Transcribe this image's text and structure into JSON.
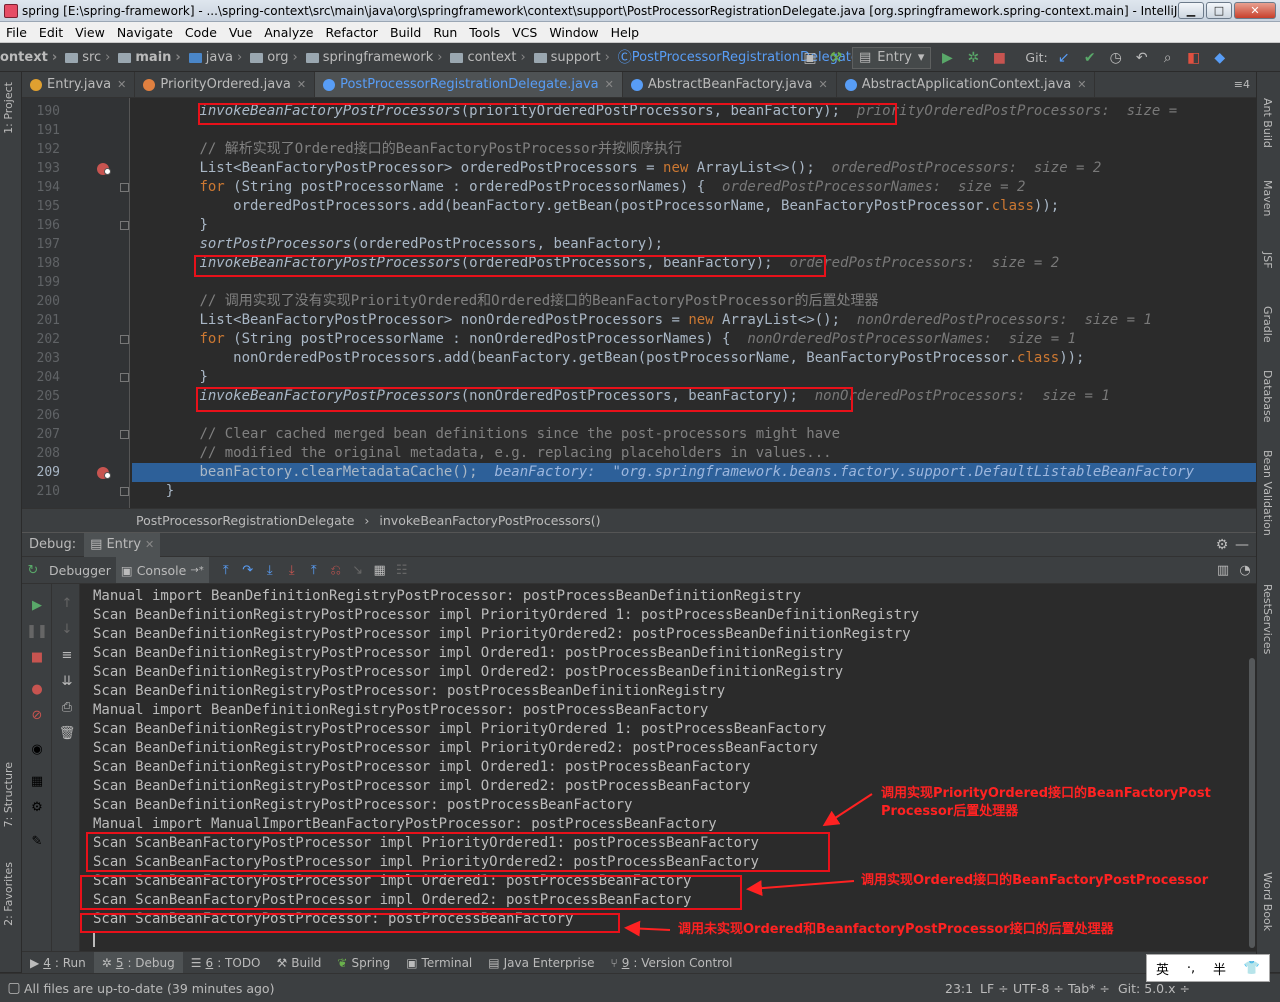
{
  "window": {
    "title": "spring [E:\\spring-framework] - ...\\spring-context\\src\\main\\java\\org\\springframework\\context\\support\\PostProcessorRegistrationDelegate.java [org.springframework.spring-context.main] - IntelliJ IDE...",
    "minimize": "▁",
    "maximize": "□",
    "close": "✕"
  },
  "menu": [
    "File",
    "Edit",
    "View",
    "Navigate",
    "Code",
    "Vue",
    "Analyze",
    "Refactor",
    "Build",
    "Run",
    "Tools",
    "VCS",
    "Window",
    "Help"
  ],
  "breadcrumbs": [
    "ontext",
    "src",
    "main",
    "java",
    "org",
    "springframework",
    "context",
    "support",
    "PostProcessorRegistrationDelegate"
  ],
  "run_config": "Entry",
  "git_label": "Git:",
  "tabs": [
    {
      "label": "Entry.java",
      "color": "#e0a030"
    },
    {
      "label": "PriorityOrdered.java",
      "color": "#e08040"
    },
    {
      "label": "PostProcessorRegistrationDelegate.java",
      "color": "#589df6"
    },
    {
      "label": "AbstractBeanFactory.java",
      "color": "#589df6"
    },
    {
      "label": "AbstractApplicationContext.java",
      "color": "#589df6"
    }
  ],
  "tab_overflow": "≡4",
  "left_tools": [
    "1: Project",
    "7: Structure",
    "2: Favorites"
  ],
  "right_tools": [
    "Ant Build",
    "Maven",
    "JSF",
    "Gradle",
    "Database",
    "Bean Validation",
    "RestServices",
    "Word Book"
  ],
  "line_numbers": [
    "190",
    "191",
    "192",
    "193",
    "194",
    "195",
    "196",
    "197",
    "198",
    "199",
    "200",
    "201",
    "202",
    "203",
    "204",
    "205",
    "206",
    "207",
    "208",
    "209",
    "210"
  ],
  "code": {
    "l190": [
      "invokeBeanFactoryPostProcessors",
      "(priorityOrderedPostProcessors, beanFactory);",
      "priorityOrderedPostProcessors:  size ="
    ],
    "l192": "// 解析实现了Ordered接口的BeanFactoryPostProcessor并按顺序执行",
    "l193": [
      "List<BeanFactoryPostProcessor> orderedPostProcessors = ",
      "new",
      " ArrayList<>();",
      "orderedPostProcessors:  size = 2"
    ],
    "l194": [
      "for",
      " (String postProcessorName : orderedPostProcessorNames) {",
      "orderedPostProcessorNames:  size = 2"
    ],
    "l195": [
      "orderedPostProcessors.add(beanFactory.getBean(postProcessorName, BeanFactoryPostProcessor.",
      "class",
      "));"
    ],
    "l196": "}",
    "l197": [
      "sortPostProcessors",
      "(orderedPostProcessors, beanFactory);"
    ],
    "l198": [
      "invokeBeanFactoryPostProcessors",
      "(orderedPostProcessors, beanFactory);",
      "orderedPostProcessors:  size = 2"
    ],
    "l200": "// 调用实现了没有实现PriorityOrdered和Ordered接口的BeanFactoryPostProcessor的后置处理器",
    "l201": [
      "List<BeanFactoryPostProcessor> nonOrderedPostProcessors = ",
      "new",
      " ArrayList<>();",
      "nonOrderedPostProcessors:  size = 1"
    ],
    "l202": [
      "for",
      " (String postProcessorName : nonOrderedPostProcessorNames) {",
      "nonOrderedPostProcessorNames:  size = 1"
    ],
    "l203": [
      "nonOrderedPostProcessors.add(beanFactory.getBean(postProcessorName, BeanFactoryPostProcessor.",
      "class",
      "));"
    ],
    "l204": "}",
    "l205": [
      "invokeBeanFactoryPostProcessors",
      "(nonOrderedPostProcessors, beanFactory);",
      "nonOrderedPostProcessors:  size = 1"
    ],
    "l207": "// Clear cached merged bean definitions since the post-processors might have",
    "l208": "// modified the original metadata, e.g. replacing placeholders in values...",
    "l209": [
      "beanFactory.clearMetadataCache();",
      "beanFactory:  \"org.springframework.beans.factory.support.DefaultListableBeanFactory"
    ],
    "l210": "}"
  },
  "editor_breadcrumb": [
    "PostProcessorRegistrationDelegate",
    "invokeBeanFactoryPostProcessors()"
  ],
  "debug": {
    "label": "Debug:",
    "session": "Entry",
    "debugger_tab": "Debugger",
    "console_tab": "Console"
  },
  "console_lines": [
    "Manual import BeanDefinitionRegistryPostProcessor: postProcessBeanDefinitionRegistry",
    "Scan BeanDefinitionRegistryPostProcessor impl PriorityOrdered 1: postProcessBeanDefinitionRegistry",
    "Scan BeanDefinitionRegistryPostProcessor impl PriorityOrdered2: postProcessBeanDefinitionRegistry",
    "Scan BeanDefinitionRegistryPostProcessor impl Ordered1: postProcessBeanDefinitionRegistry",
    "Scan BeanDefinitionRegistryPostProcessor impl Ordered2: postProcessBeanDefinitionRegistry",
    "Scan BeanDefinitionRegistryPostProcessor: postProcessBeanDefinitionRegistry",
    "Manual import BeanDefinitionRegistryPostProcessor: postProcessBeanFactory",
    "Scan BeanDefinitionRegistryPostProcessor impl PriorityOrdered 1: postProcessBeanFactory",
    "Scan BeanDefinitionRegistryPostProcessor impl PriorityOrdered2: postProcessBeanFactory",
    "Scan BeanDefinitionRegistryPostProcessor impl Ordered1: postProcessBeanFactory",
    "Scan BeanDefinitionRegistryPostProcessor impl Ordered2: postProcessBeanFactory",
    "Scan BeanDefinitionRegistryPostProcessor: postProcessBeanFactory",
    "Manual import ManualImportBeanFactoryPostProcessor: postProcessBeanFactory",
    "Scan ScanBeanFactoryPostProcessor impl PriorityOrdered1: postProcessBeanFactory",
    "Scan ScanBeanFactoryPostProcessor impl PriorityOrdered2: postProcessBeanFactory",
    "Scan ScanBeanFactoryPostProcessor impl Ordered1: postProcessBeanFactory",
    "Scan ScanBeanFactoryPostProcessor impl Ordered2: postProcessBeanFactory",
    "Scan ScanBeanFactoryPostProcessor: postProcessBeanFactory"
  ],
  "annotations": {
    "priority": [
      "调用实现PriorityOrdered接口的BeanFactoryPost",
      "Processor后置处理器"
    ],
    "ordered": "调用实现Ordered接口的BeanFactoryPostProcessor",
    "non_ordered": "调用未实现Ordered和BeanfactoryPostProcessor接口的后置处理器",
    "color": "#ff2222"
  },
  "bottom_tabs": [
    {
      "num": "4",
      "label": ": Run"
    },
    {
      "num": "5",
      "label": ": Debug"
    },
    {
      "num": "6",
      "label": ": TODO"
    },
    {
      "num": "",
      "label": "Build"
    },
    {
      "num": "",
      "label": "Spring"
    },
    {
      "num": "",
      "label": "Terminal"
    },
    {
      "num": "",
      "label": "Java Enterprise"
    },
    {
      "num": "9",
      "label": ": Version Control"
    }
  ],
  "status": {
    "message": "All files are up-to-date (39 minutes ago)",
    "position": "23:1",
    "line_sep": "LF ÷",
    "encoding": "UTF-8 ÷",
    "indent": "Tab* ÷",
    "git": "Git: 5.0.x ÷"
  },
  "ime": [
    "英",
    "·,",
    "半",
    "👕"
  ]
}
